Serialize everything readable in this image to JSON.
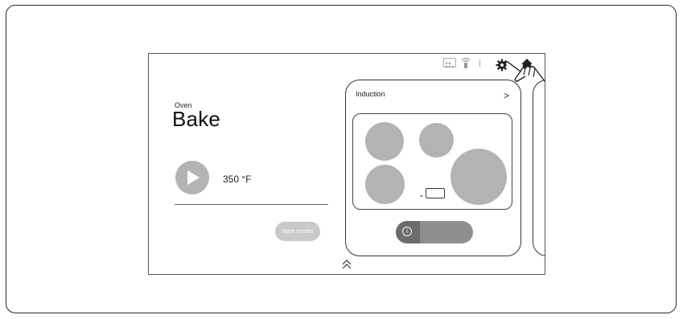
{
  "oven": {
    "label": "Oven",
    "mode": "Bake",
    "temperature": "350 °F",
    "more_modes": "More modes"
  },
  "cooktop": {
    "title": "Induction",
    "chevron": ">",
    "info_symbol": "i"
  },
  "icons": {
    "status": [
      "grid-icon",
      "wifi-icon"
    ],
    "settings": "gear-icon",
    "home": "home-icon",
    "hand": "hand-pointer-icon",
    "scroll": "double-chevron-up-icon"
  },
  "colors": {
    "burner": "#b3b3b3",
    "button_fill": "#c9c9c9",
    "power_button": "#8e8e8e"
  }
}
